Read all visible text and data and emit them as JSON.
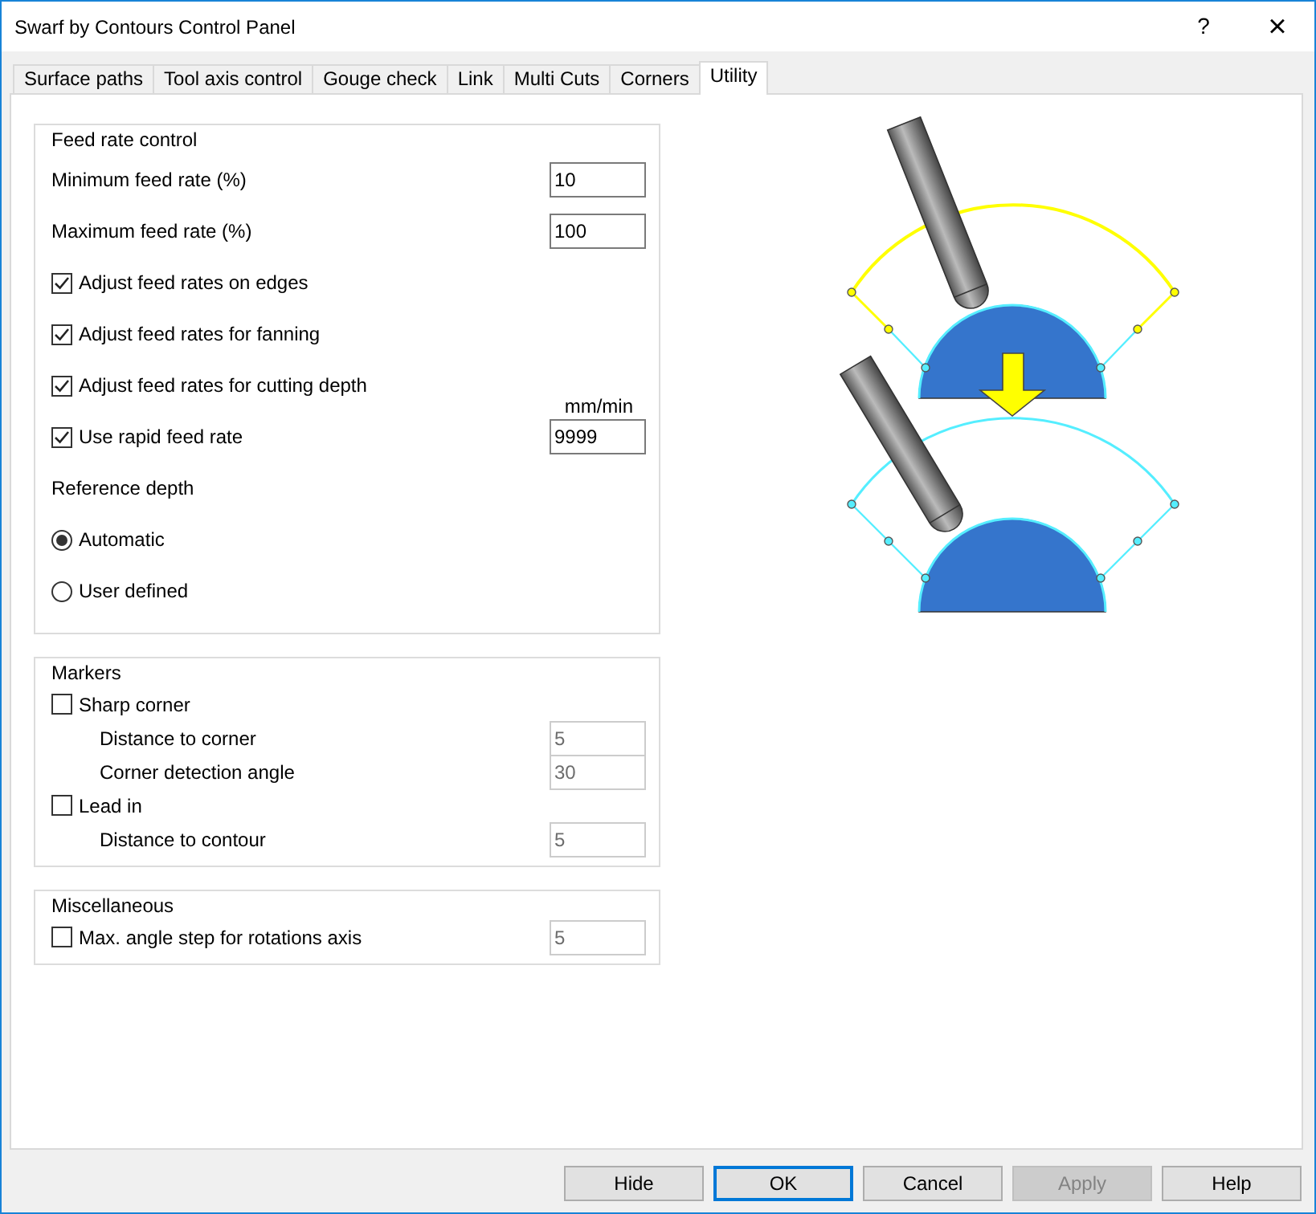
{
  "window": {
    "title": "Swarf by Contours Control Panel",
    "help": "?",
    "close": "×"
  },
  "tabs": [
    {
      "label": "Surface paths",
      "selected": false
    },
    {
      "label": "Tool axis control",
      "selected": false
    },
    {
      "label": "Gouge check",
      "selected": false
    },
    {
      "label": "Link",
      "selected": false
    },
    {
      "label": "Multi Cuts",
      "selected": false
    },
    {
      "label": "Corners",
      "selected": false
    },
    {
      "label": "Utility",
      "selected": true
    }
  ],
  "groups": [
    {
      "title": "Feed rate control",
      "rows": [
        {
          "kind": "field",
          "label": "Minimum feed rate (%)",
          "value": "10",
          "disabled": false
        },
        {
          "kind": "field",
          "label": "Maximum feed rate (%)",
          "value": "100",
          "disabled": false
        },
        {
          "kind": "checkbox",
          "label": "Adjust feed rates on edges",
          "checked": true
        },
        {
          "kind": "checkbox",
          "label": "Adjust feed rates for fanning",
          "checked": true
        },
        {
          "kind": "checkbox",
          "label": "Adjust feed rates for cutting depth",
          "checked": true
        },
        {
          "kind": "checkbox",
          "label": "Use rapid feed rate",
          "checked": true,
          "unit": "mm/min",
          "value": "9999",
          "disabled": false
        },
        {
          "kind": "label",
          "label": "Reference depth"
        },
        {
          "kind": "radio",
          "label": "Automatic",
          "selected": true
        },
        {
          "kind": "radio",
          "label": "User defined",
          "selected": false
        }
      ]
    },
    {
      "title": "Markers",
      "rows": [
        {
          "kind": "checkbox",
          "label": "Sharp corner",
          "checked": false
        },
        {
          "kind": "subfield",
          "label": "Distance to corner",
          "value": "5",
          "disabled": true
        },
        {
          "kind": "subfield",
          "label": "Corner detection angle",
          "value": "30",
          "disabled": true
        },
        {
          "kind": "checkbox",
          "label": "Lead in",
          "checked": false
        },
        {
          "kind": "subfield",
          "label": "Distance to contour",
          "value": "5",
          "disabled": true
        }
      ]
    },
    {
      "title": "Miscellaneous",
      "rows": [
        {
          "kind": "checkbox",
          "label": "Max. angle step for rotations axis",
          "checked": false,
          "value": "5",
          "disabled": true
        }
      ]
    }
  ],
  "buttons": [
    {
      "label": "Hide",
      "default": false,
      "disabled": false
    },
    {
      "label": "OK",
      "default": true,
      "disabled": false
    },
    {
      "label": "Cancel",
      "default": false,
      "disabled": false
    },
    {
      "label": "Apply",
      "default": false,
      "disabled": true
    },
    {
      "label": "Help",
      "default": false,
      "disabled": false
    }
  ]
}
